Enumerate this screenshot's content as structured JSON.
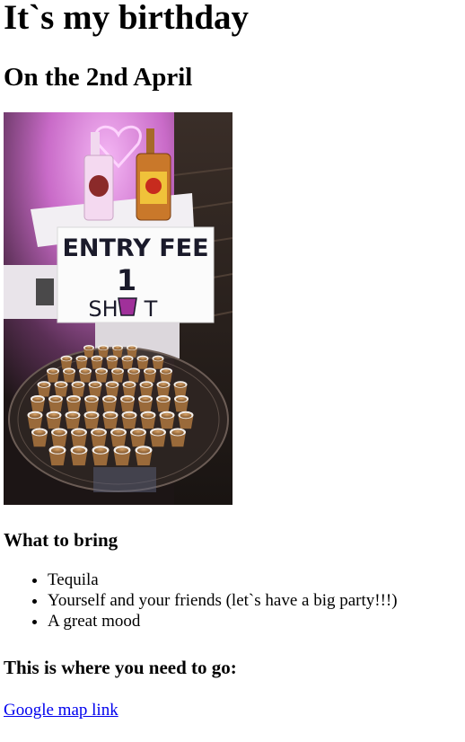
{
  "page": {
    "title": "It`s my birthday",
    "date_heading": "On the 2nd April",
    "photo": {
      "sign_line1": "ENTRY FEE",
      "sign_line2": "1",
      "sign_line3_left": "SH",
      "sign_line3_right": "T"
    },
    "bring_heading": "What to bring",
    "bring_items": [
      "Tequila",
      "Yourself and your friends (let`s have a big party!!!)",
      "A great mood"
    ],
    "go_heading": "This is where you need to go:",
    "map_link_text": "Google map link"
  },
  "colors": {
    "link": "#0000ee",
    "neon_pink": "#e07be0",
    "sign_cup": "#a0309a"
  }
}
